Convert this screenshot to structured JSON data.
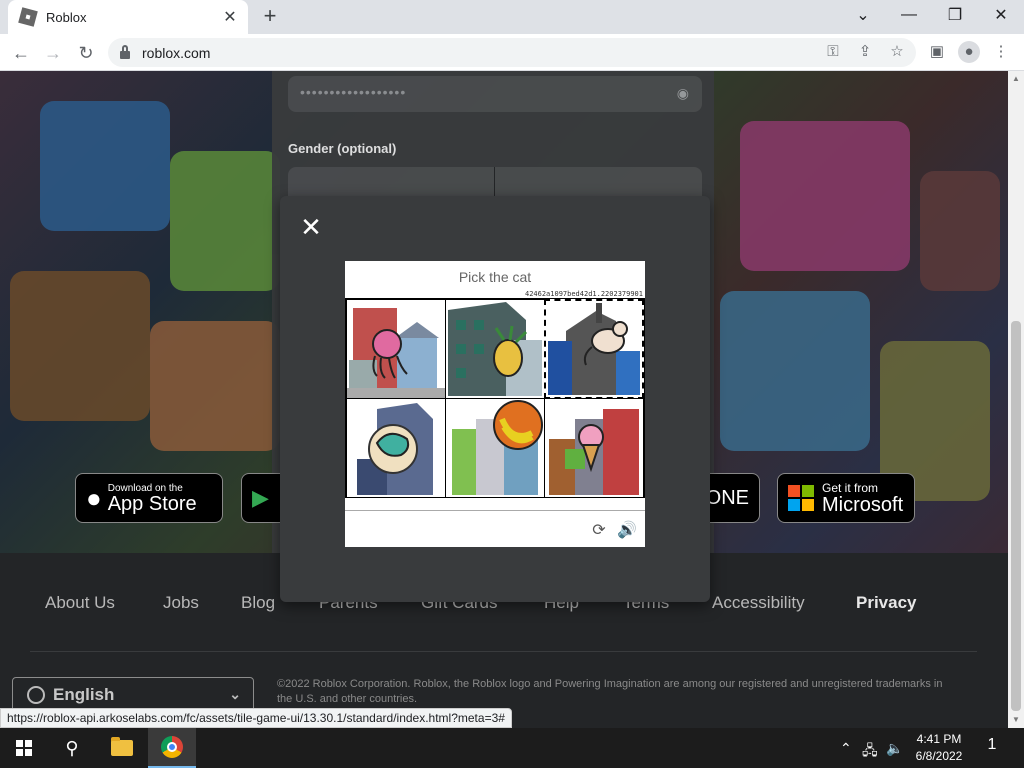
{
  "browser": {
    "tab_title": "Roblox",
    "url": "roblox.com",
    "status_url": "https://roblox-api.arkoselabs.com/fc/assets/tile-game-ui/13.30.1/standard/index.html?meta=3#"
  },
  "form": {
    "password_mask": "••••••••••••••••••",
    "gender_label": "Gender (optional)"
  },
  "stores": {
    "apple_small": "Download on the",
    "apple_big": "App Store",
    "xbox_partial": "ONE",
    "ms_small": "Get it from",
    "ms_big": "Microsoft"
  },
  "footer": {
    "links": [
      "About Us",
      "Jobs",
      "Blog",
      "Parents",
      "Gift Cards",
      "Help",
      "Terms",
      "Accessibility",
      "Privacy"
    ],
    "language": "English",
    "copyright": "©2022 Roblox Corporation. Roblox, the Roblox logo and Powering Imagination are among our registered and unregistered trademarks in the U.S. and other countries."
  },
  "captcha": {
    "prompt": "Pick the cat",
    "session_code": "42462a1097bed42d1.2202379901"
  },
  "taskbar": {
    "time": "4:41 PM",
    "date": "6/8/2022",
    "notif_count": "1"
  }
}
